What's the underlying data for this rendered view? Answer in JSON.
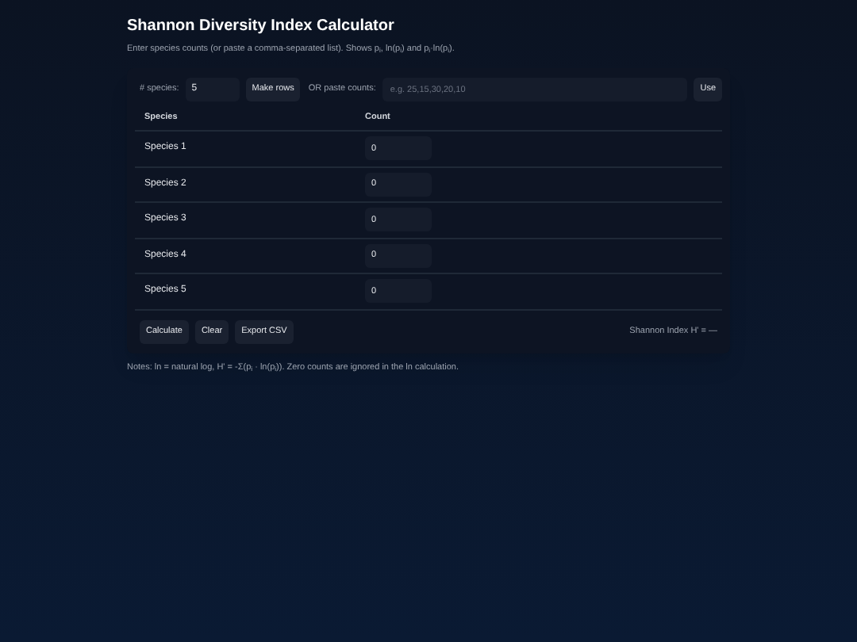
{
  "title": "Shannon Diversity Index Calculator",
  "subtitle": "Enter species counts (or paste a comma-separated list). Shows p$_{i}$, ln(p$_{i}$) and p$_{i}$·ln(p$_{i}$).",
  "controls": {
    "species_label": "# species:",
    "species_value": "5",
    "make_rows": "Make rows",
    "paste_label": "OR paste counts:",
    "paste_placeholder": "e.g. 25,15,30,20,10",
    "use": "Use"
  },
  "table": {
    "columns": [
      "Species",
      "Count"
    ],
    "rows": [
      {
        "species": "Species 1",
        "count": "0"
      },
      {
        "species": "Species 2",
        "count": "0"
      },
      {
        "species": "Species 3",
        "count": "0"
      },
      {
        "species": "Species 4",
        "count": "0"
      },
      {
        "species": "Species 5",
        "count": "0"
      }
    ]
  },
  "buttons": [
    "Calculate",
    "Clear",
    "Export CSV"
  ],
  "result": "Shannon Index H' = —",
  "notes": "Notes: ln = natural log, H' = -Σ(p$_{i}$ · ln(p$_{i}$)). Zero counts are ignored in the ln calculation."
}
